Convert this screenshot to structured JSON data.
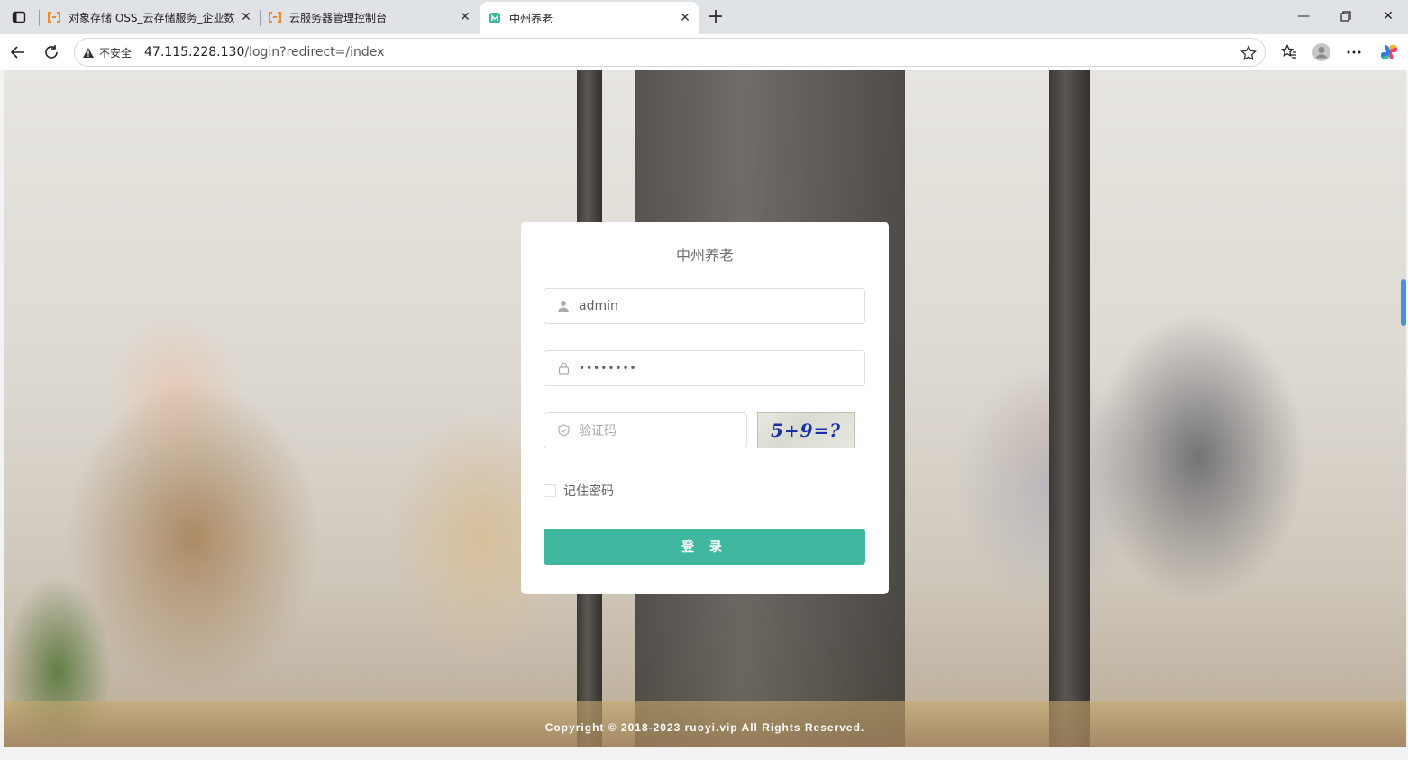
{
  "browser": {
    "tabs": [
      {
        "title": "对象存储 OSS_云存储服务_企业数",
        "favicon": "aliyun-logo-icon",
        "active": false
      },
      {
        "title": "云服务器管理控制台",
        "favicon": "aliyun-logo-icon",
        "active": false
      },
      {
        "title": "中州养老",
        "favicon": "app-logo-icon",
        "active": true
      }
    ],
    "address": {
      "security_label": "不安全",
      "url_host": "47.115.228.130",
      "url_path": "/login?redirect=/index"
    },
    "accent_color": "#3fb89f"
  },
  "login": {
    "title": "中州养老",
    "username_value": "admin",
    "password_value": "••••••••",
    "captcha_placeholder": "验证码",
    "captcha_image_text": "5+9=?",
    "remember_label": "记住密码",
    "login_button_label": "登 录"
  },
  "footer": {
    "copyright": "Copyright © 2018-2023 ruoyi.vip All Rights Reserved."
  }
}
